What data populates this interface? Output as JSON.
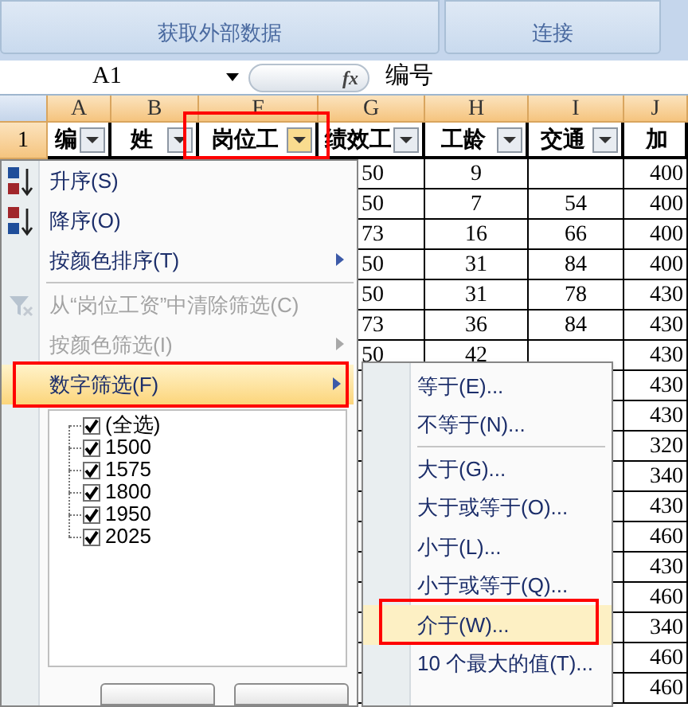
{
  "ribbon": {
    "groups": [
      "获取外部数据",
      "连接"
    ]
  },
  "formula_bar": {
    "name_box": "A1",
    "fx": "fx",
    "content": "编号"
  },
  "columns": [
    {
      "letter": "A",
      "header": "编",
      "selected": false
    },
    {
      "letter": "B",
      "header": "姓",
      "selected": false
    },
    {
      "letter": "F",
      "header": "岗位工",
      "selected": true
    },
    {
      "letter": "G",
      "header": "绩效工",
      "selected": false
    },
    {
      "letter": "H",
      "header": "工龄",
      "selected": false
    },
    {
      "letter": "I",
      "header": "交通",
      "selected": false
    },
    {
      "letter": "J",
      "header": "加"
    }
  ],
  "row_number": "1",
  "rows": [
    {
      "g": "50",
      "h": "9",
      "j": "400"
    },
    {
      "g": "50",
      "h": "7",
      "i": "54",
      "j": "400"
    },
    {
      "g": "73",
      "h": "16",
      "i": "66",
      "j": "400"
    },
    {
      "g": "50",
      "h": "31",
      "i": "84",
      "j": "400"
    },
    {
      "g": "50",
      "h": "31",
      "i": "78",
      "j": "430"
    },
    {
      "g": "73",
      "h": "36",
      "i": "84",
      "j": "430"
    },
    {
      "g": "50",
      "h": "42",
      "j": "430"
    },
    {
      "j": "430"
    },
    {
      "j": "430"
    },
    {
      "j": "320"
    },
    {
      "j": "340"
    },
    {
      "j": "430"
    },
    {
      "j": "460"
    },
    {
      "j": "430"
    },
    {
      "j": "460"
    },
    {
      "j": "340"
    },
    {
      "j": "460"
    },
    {
      "j": "460"
    }
  ],
  "sort_menu": {
    "items": [
      {
        "kind": "sort_ascending",
        "label": "升序(S)",
        "disabled": false,
        "submenu": false,
        "selected": false
      },
      {
        "kind": "sort_descending",
        "label": "降序(O)",
        "disabled": false,
        "submenu": false,
        "selected": false
      },
      {
        "kind": "item",
        "label": "按颜色排序(T)",
        "disabled": false,
        "submenu": true,
        "selected": false
      },
      {
        "kind": "separator"
      },
      {
        "kind": "clear_filter",
        "label": "从“岗位工资”中清除筛选(C)",
        "disabled": true,
        "submenu": false,
        "selected": false
      },
      {
        "kind": "item",
        "label": "按颜色筛选(I)",
        "disabled": true,
        "submenu": true,
        "selected": false
      },
      {
        "kind": "item",
        "label": "数字筛选(F)",
        "disabled": false,
        "submenu": true,
        "selected": true
      }
    ],
    "values": [
      {
        "label": "(全选)",
        "checked": true
      },
      {
        "label": "1500",
        "checked": true
      },
      {
        "label": "1575",
        "checked": true
      },
      {
        "label": "1800",
        "checked": true
      },
      {
        "label": "1950",
        "checked": true
      },
      {
        "label": "2025",
        "checked": true
      }
    ]
  },
  "number_filter_menu": {
    "items": [
      {
        "kind": "item",
        "label": "等于(E)...",
        "selected": false
      },
      {
        "kind": "item",
        "label": "不等于(N)...",
        "selected": false
      },
      {
        "kind": "separator"
      },
      {
        "kind": "item",
        "label": "大于(G)...",
        "selected": false
      },
      {
        "kind": "item",
        "label": "大于或等于(O)...",
        "selected": false
      },
      {
        "kind": "item",
        "label": "小于(L)...",
        "selected": false
      },
      {
        "kind": "item",
        "label": "小于或等于(Q)...",
        "selected": false
      },
      {
        "kind": "item",
        "label": "介于(W)...",
        "selected": true
      },
      {
        "kind": "item",
        "label": "10 个最大的值(T)...",
        "selected": false
      }
    ]
  }
}
